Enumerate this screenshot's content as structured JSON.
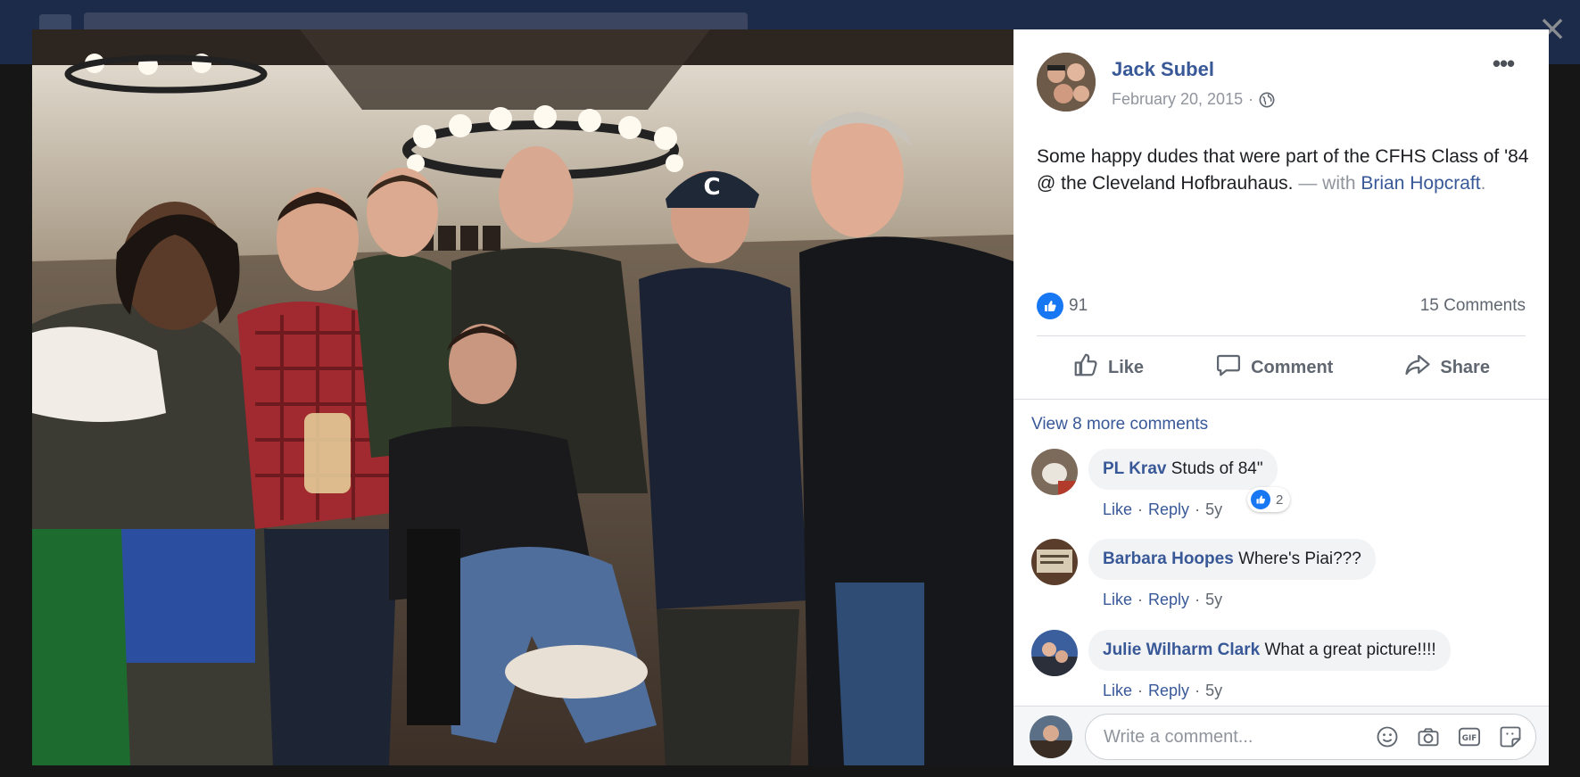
{
  "post": {
    "author": "Jack Subel",
    "date": "February 20, 2015",
    "meta_separator": "·",
    "text_main": "Some happy dudes that were part of the CFHS Class of '84 @ the Cleveland Hofbrauhaus.",
    "with_text": "— with",
    "tagged_person": "Brian Hopcraft",
    "tag_end": ".",
    "reaction_count": "91",
    "comments_count": "15 Comments"
  },
  "actions": {
    "like": "Like",
    "comment": "Comment",
    "share": "Share"
  },
  "comments_section": {
    "view_more": "View 8 more comments",
    "comments": [
      {
        "author": "PL Krav",
        "text": "Studs of 84\"",
        "like": "Like",
        "reply": "Reply",
        "time": "5y",
        "reactions": "2"
      },
      {
        "author": "Barbara Hoopes",
        "text": "Where's Piai???",
        "like": "Like",
        "reply": "Reply",
        "time": "5y"
      },
      {
        "author": "Julie Wilharm Clark",
        "text": "What a great picture!!!!",
        "like": "Like",
        "reply": "Reply",
        "time": "5y"
      }
    ]
  },
  "composer": {
    "placeholder": "Write a comment..."
  },
  "photo": {
    "cap_letter": "C"
  },
  "icons": {
    "close": "close-icon",
    "more": "more-options-icon",
    "globe": "globe-icon",
    "like": "thumbs-up-icon",
    "comment": "speech-bubble-icon",
    "share": "share-arrow-icon",
    "emoji": "smiley-icon",
    "camera": "camera-icon",
    "gif": "gif-icon",
    "sticker": "sticker-icon"
  },
  "colors": {
    "link": "#385898",
    "like_blue": "#1877f2",
    "muted": "#90949c"
  }
}
